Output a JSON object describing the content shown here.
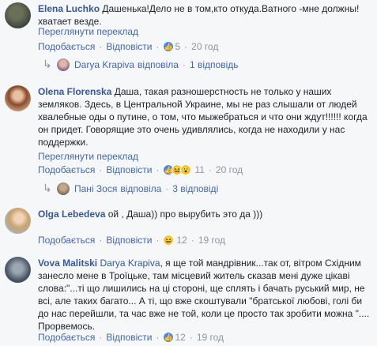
{
  "comments": [
    {
      "author": "Elena Luchko",
      "text": "Дашенька!Дело не в том,кто откуда.Ватного -мне должны! хватает везде.",
      "translate": "Переглянути переклад",
      "like": "Подобається",
      "reply": "Відповісти",
      "count": "5",
      "time": "20 год",
      "replies": {
        "name": "Darya Krapiva",
        "verb": "відповіла",
        "count": "1 відповідь"
      }
    },
    {
      "author": "Olena Florenska",
      "text": "Даша, такая разношерстность не только у наших земляков. Здесь, в Центральной Украине, мы не раз слышали от людей хвалебные оды о путине, о том, что мыжебраться и что они ждут!!!!!! когда он придет. Говорящие это очень удивлялись, когда не находили у нас поддержки.",
      "translate": "Переглянути переклад",
      "like": "Подобається",
      "reply": "Відповісти",
      "count": "11",
      "time": "20 год",
      "replies": {
        "name": "Пані Зося",
        "verb": "відповіла",
        "count": "3 відповіді"
      }
    },
    {
      "author": "Olga Lebedeva",
      "text": "ой , Даша)) про вырубить это да )))",
      "like": "Подобається",
      "reply": "Відповісти",
      "count": "12",
      "time": "19 год"
    },
    {
      "author": "Vova Malitski",
      "mention": "Darya Krapiva",
      "text": ", я ще той мандрівник...так от, вітром Східним занесло мене в Троїцьке, там місцевий житель сказав мені дуже цікаві слова:\"...ті що лишились на ці стороні, ще сплять і бачать руський мир, не всі, але таких багато... А ті, що вже скоштували \"братської любові, голі би до нас перейшли, та час вже не той, коли це просто так зробити можна \"....  Прорвемось.",
      "like": "Подобається",
      "reply": "Відповісти",
      "count": "12",
      "time": "19 год"
    }
  ],
  "icons": {
    "like": "like-icon",
    "haha": "haha-icon",
    "wow": "wow-icon",
    "reply_arrow": "reply-arrow-icon"
  },
  "colors": {
    "link": "#4267b2",
    "author": "#365899",
    "muted": "#90949c",
    "background": "#f6f7f9"
  }
}
